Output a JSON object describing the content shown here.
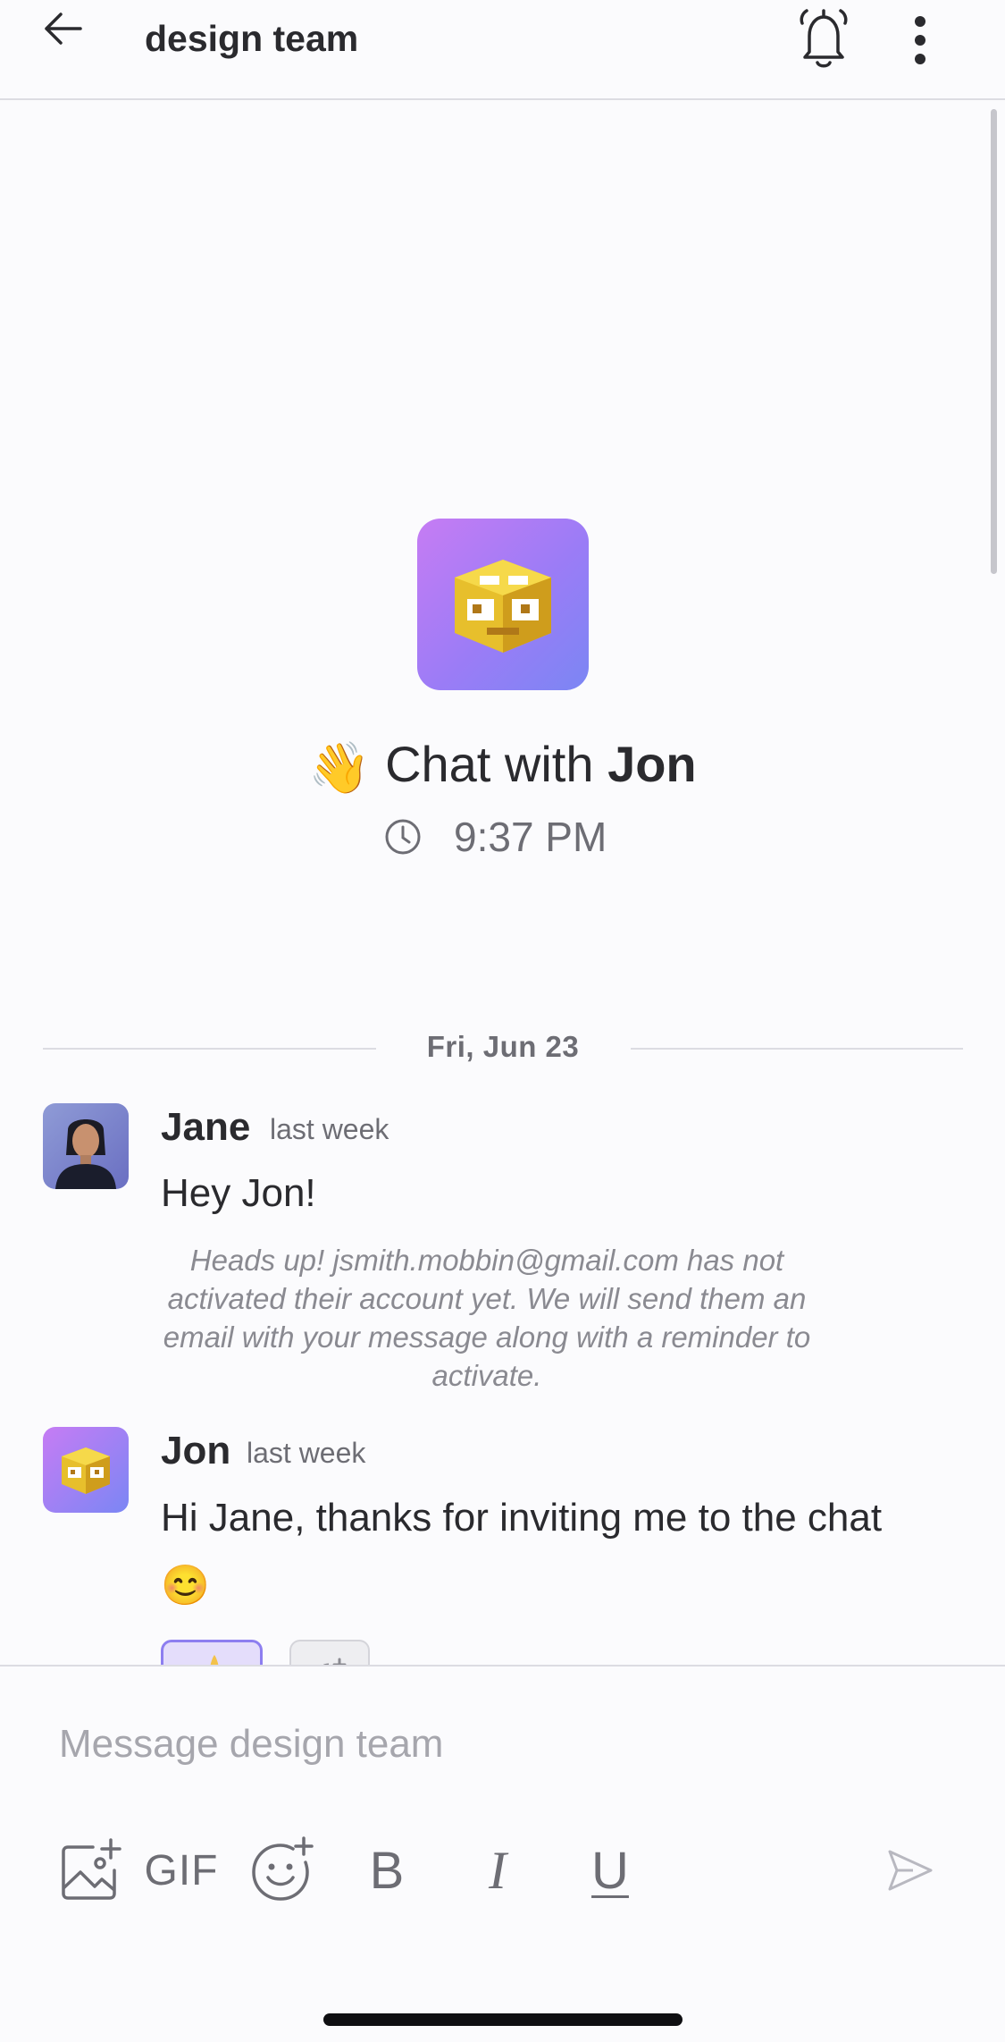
{
  "header": {
    "title": "design team",
    "back_icon": "arrow-left-icon",
    "bell_icon": "bell-icon",
    "more_icon": "more-vertical-icon"
  },
  "intro": {
    "prefix": "Chat with",
    "name": "Jon",
    "emoji": "👋",
    "time": "9:37 PM",
    "clock_icon": "clock-icon"
  },
  "divider": {
    "date": "Fri, Jun 23"
  },
  "messages": [
    {
      "sender": "Jane",
      "time": "last week",
      "text": "Hey Jon!",
      "notice": "Heads up! jsmith.mobbin@gmail.com has not activated their account yet. We will send them an email with your message along with a reminder to activate."
    },
    {
      "sender": "Jon",
      "time": "last week",
      "text": "Hi Jane, thanks for inviting me to the chat 😊"
    }
  ],
  "composer": {
    "placeholder": "Message design team",
    "gif_label": "GIF",
    "bold_label": "B",
    "italic_label": "I",
    "underline_label": "U",
    "icons": [
      "add-image-icon",
      "add-emoji-icon",
      "send-icon"
    ]
  },
  "colors": {
    "accent": "#8d7ef0",
    "avatar_gradient_start": "#c67cf4",
    "avatar_gradient_end": "#7b86f4",
    "text_primary": "#2a2a2e",
    "text_secondary": "#6d6d74"
  }
}
